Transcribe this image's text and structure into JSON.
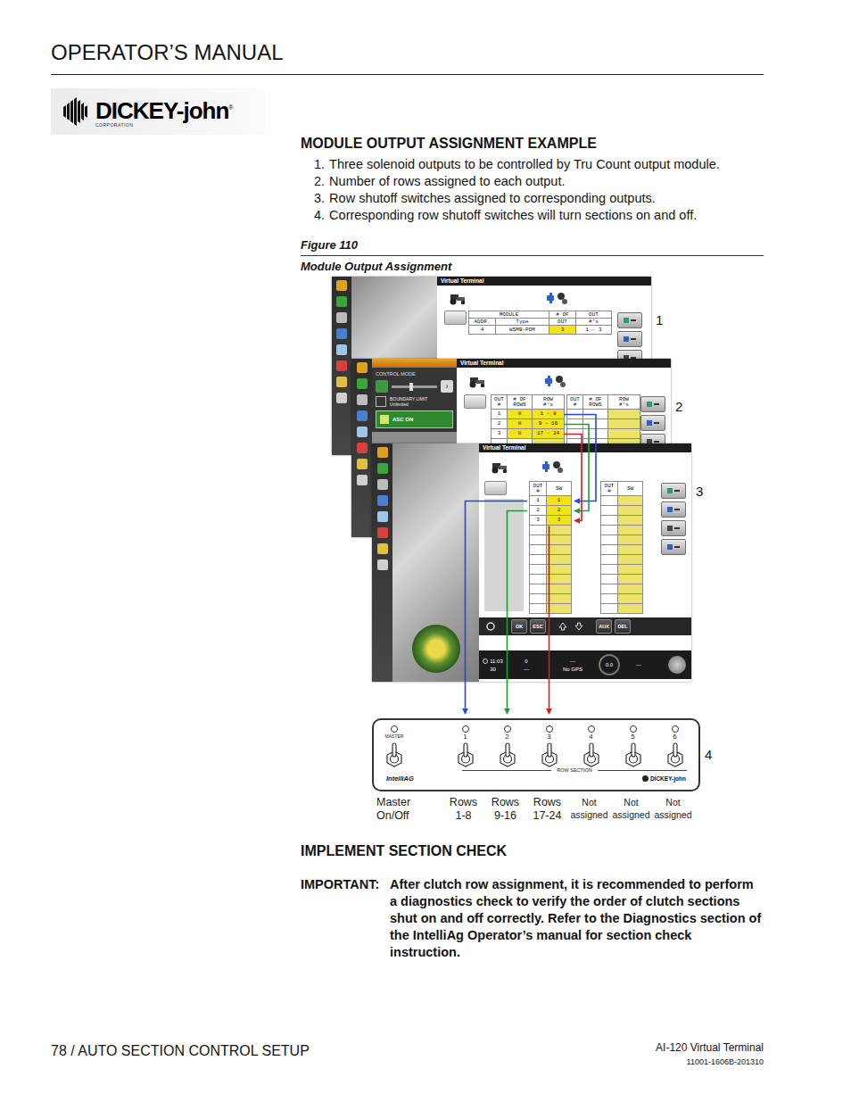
{
  "header": {
    "title": "OPERATOR’S MANUAL"
  },
  "logo": {
    "name": "DICKEY-john",
    "mark": "®",
    "subtitle": "CORPORATION"
  },
  "section1": {
    "heading": "MODULE OUTPUT ASSIGNMENT EXAMPLE",
    "steps": [
      {
        "number": "1.",
        "text": "Three solenoid outputs to be controlled by Tru Count output module."
      },
      {
        "number": "2.",
        "text": "Number of rows assigned to each output."
      },
      {
        "number": "3.",
        "text": "Row shutoff switches assigned to corresponding outputs."
      },
      {
        "number": "4.",
        "text": "Corresponding row shutoff switches will turn sections on and off."
      }
    ]
  },
  "figure": {
    "label": "Figure 110",
    "caption": "Module Output Assignment",
    "callouts": [
      "1",
      "2",
      "3",
      "4"
    ],
    "screen1": {
      "title": "Virtual Terminal",
      "group_label": "MODULE",
      "columns": [
        {
          "top": "",
          "label": "ADDR."
        },
        {
          "top": "",
          "label": "Type"
        },
        {
          "top": "# OF",
          "label": "OUT"
        },
        {
          "top": "OUT",
          "label": "#'s"
        }
      ],
      "row": [
        {
          "text": "4",
          "highlighted": false
        },
        {
          "text": "WSMB-POM",
          "highlighted": false
        },
        {
          "text": "3",
          "highlighted": true
        },
        {
          "text": "1 - 3",
          "highlighted": false
        }
      ]
    },
    "screen2": {
      "title": "Virtual Terminal",
      "panel": {
        "label": "CONTROL MODE",
        "arrow": "›",
        "boundary_label": "BOUNDARY LIMIT",
        "boundary_value": "Unlimited",
        "asc_label": "ASC ON",
        "asc_on": true
      },
      "columns": [
        {
          "lines": [
            "OUT",
            "#"
          ]
        },
        {
          "lines": [
            "# OF",
            "ROWS"
          ]
        },
        {
          "lines": [
            "ROW",
            "#'s"
          ]
        }
      ],
      "rows": [
        {
          "out": "1",
          "count": "8",
          "range": "1 - 8"
        },
        {
          "out": "2",
          "count": "8",
          "range": "9 - 16"
        },
        {
          "out": "3",
          "count": "8",
          "range": "17 - 24"
        }
      ]
    },
    "screen3": {
      "title": "Virtual Terminal",
      "columns": [
        {
          "lines": [
            "OUT",
            "#"
          ]
        },
        {
          "lines": [
            "SW"
          ]
        }
      ],
      "rows": [
        {
          "out": "1",
          "sw": "1"
        },
        {
          "out": "2",
          "sw": "2"
        },
        {
          "out": "3",
          "sw": "3"
        }
      ],
      "buttons": [
        "OK",
        "ESC",
        "AUX",
        "DEL"
      ],
      "status": {
        "time": "11:03",
        "limit": "30",
        "count": "0",
        "count_detail": "---",
        "gps_top": "---",
        "gps": "No GPS",
        "gauge": "0.0",
        "right": "---"
      }
    },
    "switch_panel": {
      "master": "MASTER",
      "section_label": "ROW SECTION",
      "brand_left": "IntelliAG",
      "brand_right": "DICKEY-john",
      "master_caption": [
        "Master",
        "On/Off"
      ],
      "switches": [
        {
          "number": "1",
          "caption": [
            "Rows",
            "1-8"
          ],
          "assigned": true,
          "color": "#2148d8"
        },
        {
          "number": "2",
          "caption": [
            "Rows",
            "9-16"
          ],
          "assigned": true,
          "color": "#1e9a3a"
        },
        {
          "number": "3",
          "caption": [
            "Rows",
            "17-24"
          ],
          "assigned": true,
          "color": "#d41e1e"
        },
        {
          "number": "4",
          "caption": [
            "Not",
            "assigned"
          ],
          "assigned": false
        },
        {
          "number": "5",
          "caption": [
            "Not",
            "assigned"
          ],
          "assigned": false
        },
        {
          "number": "6",
          "caption": [
            "Not",
            "assigned"
          ],
          "assigned": false
        }
      ]
    }
  },
  "section2": {
    "heading": "IMPLEMENT SECTION CHECK",
    "important_label": "IMPORTANT:",
    "important_text": "After clutch row assignment, it is recommended to perform a diagnostics check to verify the order of clutch sections shut on and off correctly. Refer to the Diagnostics section of the IntelliAg Operator’s manual for section check instruction."
  },
  "footer": {
    "section": "78 / AUTO SECTION CONTROL SETUP",
    "product": "AI-120 Virtual Terminal",
    "doc": "11001-1606B-201310"
  }
}
